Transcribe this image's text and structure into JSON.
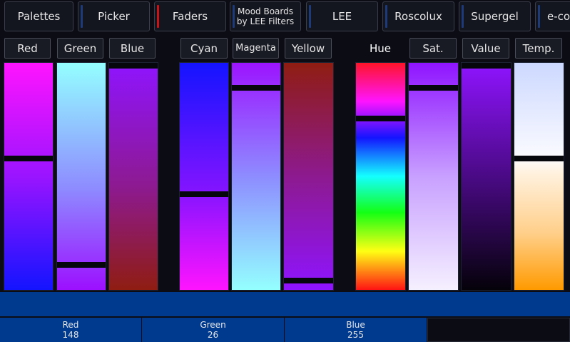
{
  "tabs": {
    "palettes": "Palettes",
    "picker": "Picker",
    "faders": "Faders",
    "mood_boards_line1": "Mood Boards",
    "mood_boards_line2": "by LEE Filters",
    "lee": "LEE",
    "roscolux": "Roscolux",
    "supergel": "Supergel",
    "ecolour": "e-co"
  },
  "tab_colors": {
    "active_stripe": "#c81414",
    "inactive_stripe": "#1f3a78"
  },
  "channels": {
    "red": "Red",
    "green": "Green",
    "blue": "Blue",
    "cyan": "Cyan",
    "magenta": "Magenta",
    "yellow": "Yellow",
    "hue": "Hue",
    "sat": "Sat.",
    "value": "Value",
    "temp": "Temp."
  },
  "fader_levels": {
    "red": 0.58,
    "green": 0.1,
    "blue": 1.0,
    "cyan": 0.42,
    "magenta": 0.9,
    "yellow": 0.03,
    "hue": 0.76,
    "sat": 0.9,
    "value": 1.0,
    "temp": 0.58
  },
  "readouts": [
    {
      "label": "Red",
      "value": "148"
    },
    {
      "label": "Green",
      "value": "26"
    },
    {
      "label": "Blue",
      "value": "255"
    }
  ],
  "current_color": "#003a8e"
}
